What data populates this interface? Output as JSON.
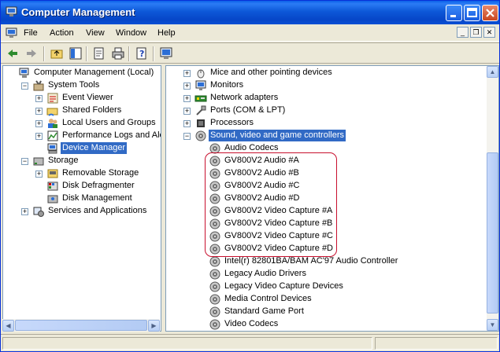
{
  "window": {
    "title": "Computer Management"
  },
  "menu": [
    "File",
    "Action",
    "View",
    "Window",
    "Help"
  ],
  "toolbar_icons": [
    "back-icon",
    "forward-icon",
    "up-folder-icon",
    "show-hide-tree-icon",
    "properties-icon",
    "print-icon",
    "help-icon",
    "scan-hardware-icon"
  ],
  "left_tree": [
    {
      "label": "Computer Management (Local)",
      "icon": "computer-icon",
      "level": 0,
      "expander": "none"
    },
    {
      "label": "System Tools",
      "icon": "tools-icon",
      "level": 1,
      "expander": "minus"
    },
    {
      "label": "Event Viewer",
      "icon": "event-viewer-icon",
      "level": 2,
      "expander": "plus"
    },
    {
      "label": "Shared Folders",
      "icon": "shared-folder-icon",
      "level": 2,
      "expander": "plus"
    },
    {
      "label": "Local Users and Groups",
      "icon": "users-icon",
      "level": 2,
      "expander": "plus"
    },
    {
      "label": "Performance Logs and Alerts",
      "icon": "performance-icon",
      "level": 2,
      "expander": "plus"
    },
    {
      "label": "Device Manager",
      "icon": "device-manager-icon",
      "level": 2,
      "expander": "none",
      "selected": true
    },
    {
      "label": "Storage",
      "icon": "storage-icon",
      "level": 1,
      "expander": "minus"
    },
    {
      "label": "Removable Storage",
      "icon": "removable-storage-icon",
      "level": 2,
      "expander": "plus"
    },
    {
      "label": "Disk Defragmenter",
      "icon": "defrag-icon",
      "level": 2,
      "expander": "none"
    },
    {
      "label": "Disk Management",
      "icon": "disk-management-icon",
      "level": 2,
      "expander": "none"
    },
    {
      "label": "Services and Applications",
      "icon": "services-icon",
      "level": 1,
      "expander": "plus"
    }
  ],
  "right_tree": [
    {
      "label": "Mice and other pointing devices",
      "icon": "mouse-icon",
      "level": 0,
      "expander": "plus"
    },
    {
      "label": "Monitors",
      "icon": "monitor-icon",
      "level": 0,
      "expander": "plus"
    },
    {
      "label": "Network adapters",
      "icon": "network-adapter-icon",
      "level": 0,
      "expander": "plus"
    },
    {
      "label": "Ports (COM & LPT)",
      "icon": "port-icon",
      "level": 0,
      "expander": "plus"
    },
    {
      "label": "Processors",
      "icon": "processor-icon",
      "level": 0,
      "expander": "plus"
    },
    {
      "label": "Sound, video and game controllers",
      "icon": "speaker-icon",
      "level": 0,
      "expander": "minus",
      "selected": true
    },
    {
      "label": "Audio Codecs",
      "icon": "speaker-icon",
      "level": 1,
      "expander": "none"
    },
    {
      "label": "GV800V2 Audio #A",
      "icon": "speaker-icon",
      "level": 1,
      "expander": "none"
    },
    {
      "label": "GV800V2 Audio #B",
      "icon": "speaker-icon",
      "level": 1,
      "expander": "none"
    },
    {
      "label": "GV800V2 Audio #C",
      "icon": "speaker-icon",
      "level": 1,
      "expander": "none"
    },
    {
      "label": "GV800V2 Audio #D",
      "icon": "speaker-icon",
      "level": 1,
      "expander": "none"
    },
    {
      "label": "GV800V2 Video Capture #A",
      "icon": "speaker-icon",
      "level": 1,
      "expander": "none"
    },
    {
      "label": "GV800V2 Video Capture #B",
      "icon": "speaker-icon",
      "level": 1,
      "expander": "none"
    },
    {
      "label": "GV800V2 Video Capture #C",
      "icon": "speaker-icon",
      "level": 1,
      "expander": "none"
    },
    {
      "label": "GV800V2 Video Capture #D",
      "icon": "speaker-icon",
      "level": 1,
      "expander": "none"
    },
    {
      "label": "Intel(r) 82801BA/BAM AC'97 Audio Controller",
      "icon": "speaker-icon",
      "level": 1,
      "expander": "none"
    },
    {
      "label": "Legacy Audio Drivers",
      "icon": "speaker-icon",
      "level": 1,
      "expander": "none"
    },
    {
      "label": "Legacy Video Capture Devices",
      "icon": "speaker-icon",
      "level": 1,
      "expander": "none"
    },
    {
      "label": "Media Control Devices",
      "icon": "speaker-icon",
      "level": 1,
      "expander": "none"
    },
    {
      "label": "Standard Game Port",
      "icon": "speaker-icon",
      "level": 1,
      "expander": "none"
    },
    {
      "label": "Video Codecs",
      "icon": "speaker-icon",
      "level": 1,
      "expander": "none"
    }
  ],
  "colors": {
    "selection": "#316ac5",
    "highlight_box": "#c8102e",
    "title_bar": "#0a5fe8"
  }
}
